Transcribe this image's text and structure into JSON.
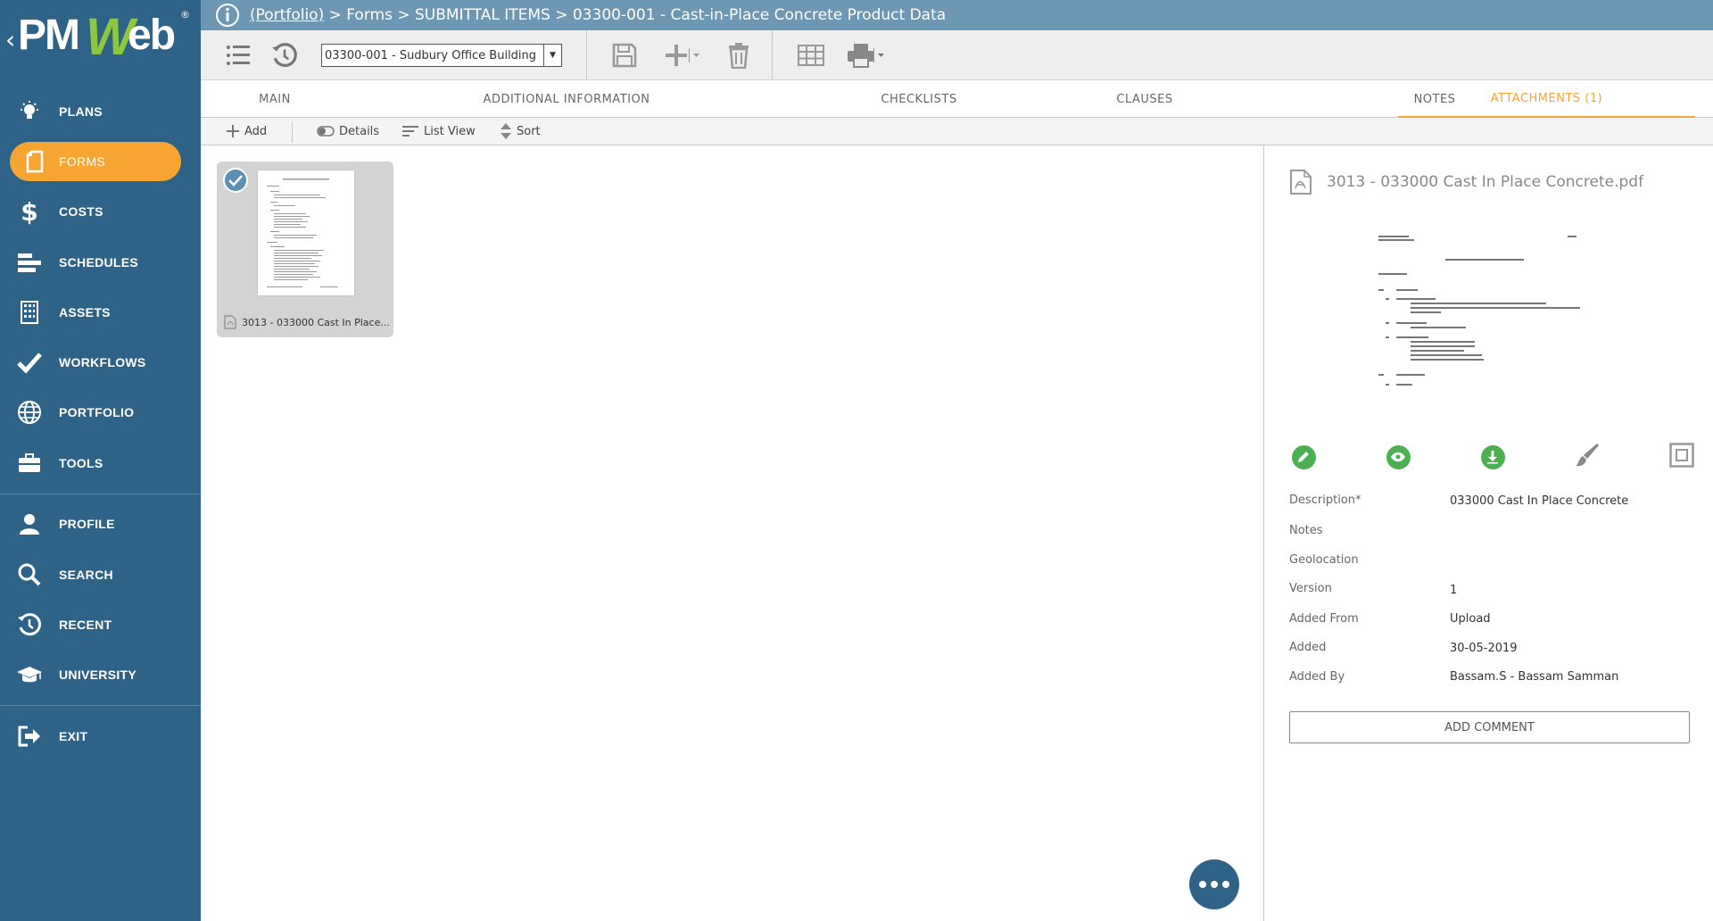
{
  "logo": {
    "chevron": "‹",
    "text_pm": "PM",
    "text_w": "W",
    "text_eb": "eb",
    "registered": "®"
  },
  "sidebar": {
    "items": [
      {
        "label": "PLANS",
        "icon": "lightbulb-icon"
      },
      {
        "label": "FORMS",
        "icon": "forms-icon",
        "active": true
      },
      {
        "label": "COSTS",
        "icon": "dollar-icon"
      },
      {
        "label": "SCHEDULES",
        "icon": "schedule-bars-icon"
      },
      {
        "label": "ASSETS",
        "icon": "building-icon"
      },
      {
        "label": "WORKFLOWS",
        "icon": "checkmark-icon"
      },
      {
        "label": "PORTFOLIO",
        "icon": "globe-icon"
      },
      {
        "label": "TOOLS",
        "icon": "toolbox-icon"
      },
      {
        "label": "PROFILE",
        "icon": "user-icon"
      },
      {
        "label": "SEARCH",
        "icon": "search-icon"
      },
      {
        "label": "RECENT",
        "icon": "history-icon"
      },
      {
        "label": "UNIVERSITY",
        "icon": "graduation-cap-icon"
      },
      {
        "label": "EXIT",
        "icon": "exit-icon"
      }
    ]
  },
  "header": {
    "portfolio_link": "(Portfolio)",
    "breadcrumb_rest": " > Forms > SUBMITTAL ITEMS > 03300-001 - Cast-in-Place Concrete Product Data"
  },
  "toolbar": {
    "project_select_value": "03300-001 - Sudbury Office Building",
    "icons": [
      "list-icon",
      "history-icon",
      "save-icon",
      "add-icon",
      "delete-icon",
      "grid-icon",
      "print-icon"
    ]
  },
  "tabs": [
    {
      "label": "MAIN"
    },
    {
      "label": "ADDITIONAL INFORMATION"
    },
    {
      "label": "CHECKLISTS"
    },
    {
      "label": "CLAUSES"
    },
    {
      "label": "NOTES"
    },
    {
      "label": "ATTACHMENTS (1)",
      "active": true
    }
  ],
  "subbar": {
    "add": "Add",
    "details": "Details",
    "list_view": "List View",
    "sort": "Sort"
  },
  "attachment": {
    "thumb_label": "3013 - 033000 Cast In Place...",
    "file_name": "3013 - 033000 Cast In Place Concrete.pdf"
  },
  "details": {
    "fields": [
      {
        "label": "Description*",
        "value": "033000 Cast In Place Concrete"
      },
      {
        "label": "Notes",
        "value": ""
      },
      {
        "label": "Geolocation",
        "value": ""
      },
      {
        "label": "Version",
        "value": "1"
      },
      {
        "label": "Added From",
        "value": "Upload"
      },
      {
        "label": "Added",
        "value": "30-05-2019"
      },
      {
        "label": "Added By",
        "value": "Bassam.S - Bassam Samman"
      }
    ],
    "add_comment": "ADD COMMENT"
  },
  "colors": {
    "sidebar_bg": "#2e6387",
    "topbar_bg": "#6e97b3",
    "accent": "#f7a532",
    "action_green": "#4caf50",
    "logo_green": "#8dc63f"
  }
}
